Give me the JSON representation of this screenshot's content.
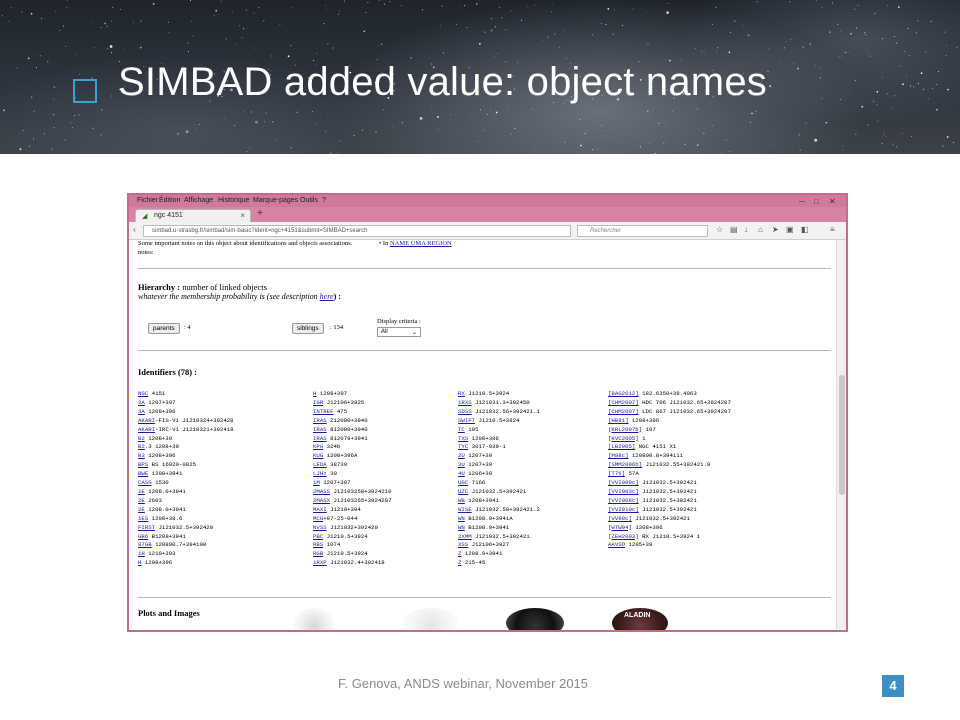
{
  "slide": {
    "title": "SIMBAD added value: object names",
    "footer": "F. Genova, ANDS webinar, November 2015",
    "page_number": "4"
  },
  "browser": {
    "menu": [
      "Fichier",
      "Édition",
      "Affichage",
      "Historique",
      "Marque-pages",
      "Outils",
      "?"
    ],
    "tab_title": "ngc 4151",
    "url": "simbad.u-strasbg.fr/simbad/sim-basic?ident=ngc+4151&submit=SIMBAD+search",
    "search_placeholder": "Rechercher"
  },
  "page": {
    "notes_line": "Some important notes on this object about identifications and objects associations.",
    "notes_label": "notes:",
    "in_label": "In",
    "in_link": "NAME UMA REGION",
    "hierarchy_title": "Hierarchy :",
    "hierarchy_rest": "number of linked objects",
    "membership_text": "whatever the membership probability is (see description",
    "membership_link": "here",
    "membership_end": ") :",
    "parents_label": "parents",
    "parents_count": ": 4",
    "siblings_label": "siblings",
    "siblings_count": ": 134",
    "display_criteria": "Display criteria :",
    "display_value": "All",
    "identifiers_title": "Identifiers (78) :",
    "plots_title": "Plots and Images",
    "identifiers": [
      [
        [
          "NGC",
          "4151"
        ],
        [
          "2A",
          "1207+397"
        ],
        [
          "3A",
          "1208+396"
        ],
        [
          "AKARI",
          "-FIS-V1 J1210324+392428"
        ],
        [
          "AKARI",
          "-IRC-V1 J1210321+392418"
        ],
        [
          "B2",
          "1208+39"
        ],
        [
          "B2",
          ".3 1208+39"
        ],
        [
          "B3",
          "1208+396"
        ],
        [
          "BPS",
          "BS 16920-0025"
        ],
        [
          "BWE",
          "1208+3941"
        ],
        [
          "CASG",
          "1530"
        ],
        [
          "1E",
          "1208.0+3941"
        ],
        [
          "2E",
          "2603"
        ],
        [
          "2E",
          "1208.0+3941"
        ],
        [
          "1ES",
          "1208+39.6"
        ],
        [
          "FIRST",
          "J121032.5+392420"
        ],
        [
          "GB6",
          "B1208+3941"
        ],
        [
          "87GB",
          "120800.7+394100"
        ],
        [
          "1H",
          "1210+393"
        ],
        [
          "H",
          "1208+396"
        ]
      ],
      [
        [
          "H",
          "1208+397"
        ],
        [
          "IGR",
          "J12106+3925"
        ],
        [
          "INTREF",
          "475"
        ],
        [
          "IRAS",
          "Z12080+3940"
        ],
        [
          "IRAS",
          "812080+3940"
        ],
        [
          "IRAS",
          "812079+3941"
        ],
        [
          "KPG",
          "324b"
        ],
        [
          "KUG",
          "1208+396A"
        ],
        [
          "LEDA",
          "38739"
        ],
        [
          "LJHY",
          "30"
        ],
        [
          "1M",
          "1207+397"
        ],
        [
          "2MASS",
          "J12103258+3924210"
        ],
        [
          "2MASX",
          "J12103265+3924207"
        ],
        [
          "MAXI",
          "J1210+394"
        ],
        [
          "MCG",
          "+07-25-044"
        ],
        [
          "NVSS",
          "J121032+392420"
        ],
        [
          "PBC",
          "J1210.5+3924"
        ],
        [
          "RBS",
          "1074"
        ],
        [
          "RGB",
          "J1210.5+3924"
        ],
        [
          "1RXP",
          "J121032.4+392418"
        ]
      ],
      [
        [
          "RX",
          "J1210.5+3924"
        ],
        [
          "1RXS",
          "J121031.3+392450"
        ],
        [
          "SDSS",
          "J121032.56+392421.1"
        ],
        [
          "SWIFT",
          "J1210.5+3924"
        ],
        [
          "TC",
          "195"
        ],
        [
          "TXS",
          "1208+396"
        ],
        [
          "TYC",
          "3017-939-1"
        ],
        [
          "2U",
          "1207+39"
        ],
        [
          "3U",
          "1207+39"
        ],
        [
          "4U",
          "1206+39"
        ],
        [
          "UGC",
          "7166"
        ],
        [
          "UZC",
          "J121032.5+392421"
        ],
        [
          "WB",
          "1208+3941"
        ],
        [
          "WISE",
          "J121032.58+392421.2"
        ],
        [
          "WN",
          "B1208.0+3941A"
        ],
        [
          "WN",
          "B1208.0+3941"
        ],
        [
          "2XMM",
          "J121032.5+392421"
        ],
        [
          "XSS",
          "J12106+3927"
        ],
        [
          "Z",
          "1208.0+3941"
        ],
        [
          "Z",
          "215-45"
        ]
      ],
      [
        [
          "[BAG2012]",
          "182.6350+39.4063"
        ],
        [
          "[CHM2007]",
          "HDC 706 J121032.65+3924207"
        ],
        [
          "[CHM2007]",
          "LDC 867 J121032.65+3924207"
        ],
        [
          "[HB91]",
          "1208+396"
        ],
        [
          "[KRL2007b]",
          "107"
        ],
        [
          "[KVC2005]",
          "1"
        ],
        [
          "[LB2005]",
          "NGC 4151 X1"
        ],
        [
          "[M98c]",
          "120800.8+394111"
        ],
        [
          "[SMM2006b]",
          "J121032.55+392421.0"
        ],
        [
          "[T76]",
          "57A"
        ],
        [
          "[VV2000c]",
          "J121032.5+392421"
        ],
        [
          "[VV2003c]",
          "J121032.5+392421"
        ],
        [
          "[VV2006c]",
          "J121032.5+392421"
        ],
        [
          "[VV2010c]",
          "J121032.5+392421"
        ],
        [
          "[VV98c]",
          "J121032.5+392421"
        ],
        [
          "[WTW94]",
          "1208+396"
        ],
        [
          "[ZEH2003]",
          "RX J1210.5+3924 1"
        ],
        [
          "AAVSO",
          "1205+39"
        ]
      ]
    ],
    "thumb_label": "ALADIN"
  },
  "colors": {
    "frame": "#c86a8e",
    "accent": "#3d8ec3",
    "link": "#1a1aa6"
  }
}
